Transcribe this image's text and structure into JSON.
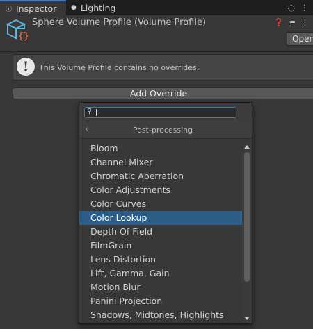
{
  "tabs": {
    "inspector": "Inspector",
    "lighting": "Lighting"
  },
  "header": {
    "title": "Sphere Volume Profile (Volume Profile)",
    "open_label": "Open"
  },
  "help": {
    "message": "This Volume Profile contains no overrides."
  },
  "add_override_label": "Add Override",
  "dropdown": {
    "search_value": "",
    "category": "Post-processing",
    "items": [
      "Bloom",
      "Channel Mixer",
      "Chromatic Aberration",
      "Color Adjustments",
      "Color Curves",
      "Color Lookup",
      "Depth Of Field",
      "FilmGrain",
      "Lens Distortion",
      "Lift, Gamma, Gain",
      "Motion Blur",
      "Panini Projection",
      "Shadows, Midtones, Highlights"
    ],
    "selected_index": 5
  },
  "colors": {
    "accent": "#3a79bb",
    "selection": "#2c5d87",
    "asset_icon_cube": "#5ab7e0",
    "asset_icon_braces": "#e0623a"
  }
}
